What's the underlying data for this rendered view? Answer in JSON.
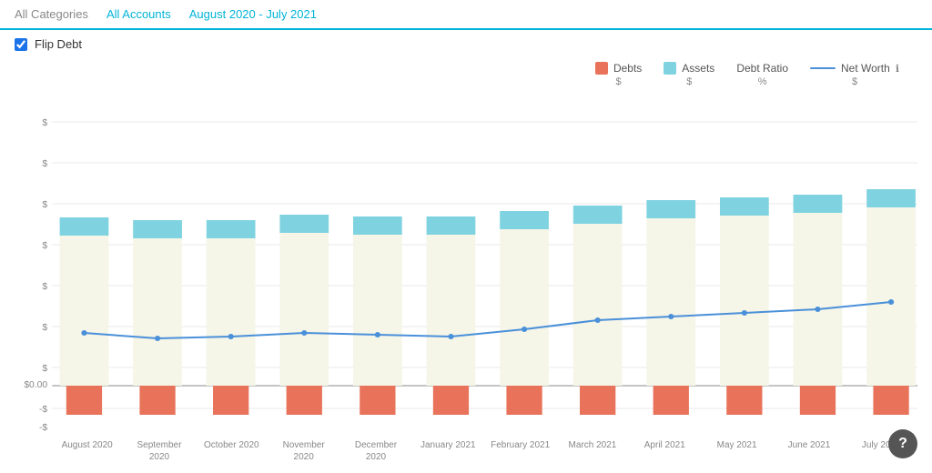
{
  "header": {
    "all_categories_label": "All Categories",
    "all_accounts_label": "All Accounts",
    "date_range_label": "August 2020 - July 2021"
  },
  "flip_debt": {
    "label": "Flip Debt",
    "checked": true
  },
  "legend": {
    "debts": {
      "label": "Debts",
      "unit": "$"
    },
    "assets": {
      "label": "Assets",
      "unit": "$"
    },
    "debt_ratio": {
      "label": "Debt Ratio",
      "unit": "%"
    },
    "net_worth": {
      "label": "Net Worth",
      "unit": "$",
      "icon": "ℹ"
    }
  },
  "y_axis": {
    "labels": [
      "-$",
      "-$",
      "$0.00",
      "$",
      "$",
      "$",
      "$",
      "$",
      "$"
    ]
  },
  "x_axis": {
    "months": [
      "August 2020",
      "September 2020",
      "October 2020",
      "November 2020",
      "December 2020",
      "January 2021",
      "February 2021",
      "March 2021",
      "April 2021",
      "May 2021",
      "June 2021",
      "July 2021"
    ]
  },
  "chart": {
    "asset_heights": [
      58,
      57,
      57,
      59,
      58,
      58,
      61,
      63,
      66,
      67,
      68,
      72
    ],
    "debt_heights": [
      18,
      18,
      18,
      18,
      18,
      18,
      18,
      18,
      18,
      18,
      18,
      18
    ],
    "net_worth_points": [
      40,
      38,
      39,
      40,
      40,
      39,
      42,
      46,
      48,
      50,
      52,
      56
    ],
    "colors": {
      "assets_fill": "#7fd3e0",
      "assets_bg": "#f5f5e8",
      "debts": "#e8735a",
      "net_worth_line": "#4a90d9",
      "grid": "#e8e8e8"
    }
  },
  "help_button": {
    "label": "?"
  }
}
